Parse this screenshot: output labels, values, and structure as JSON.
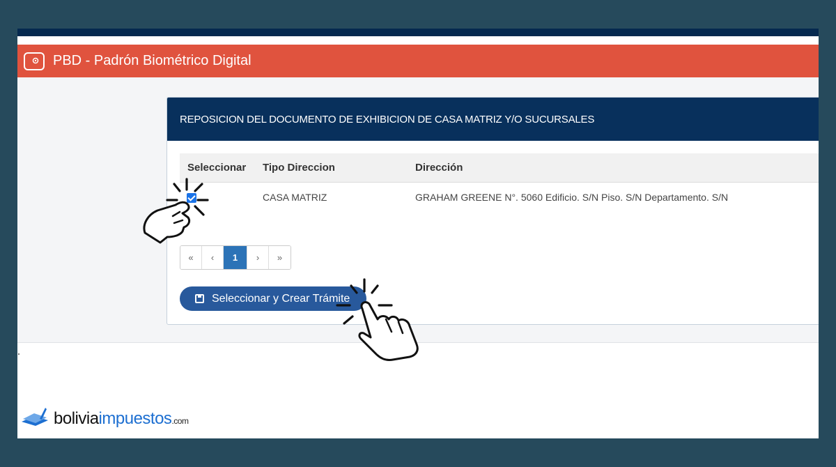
{
  "app": {
    "title": "PBD - Padrón Biométrico Digital"
  },
  "panel": {
    "title": "REPOSICION DEL DOCUMENTO DE EXHIBICION DE CASA MATRIZ Y/O SUCURSALES"
  },
  "table": {
    "headers": [
      "Seleccionar",
      "Tipo Direccion",
      "Dirección"
    ],
    "rows": [
      {
        "selected": true,
        "tipo": "CASA MATRIZ",
        "direccion": "GRAHAM GREENE N°. 5060 Edificio. S/N Piso. S/N Departamento. S/N"
      }
    ]
  },
  "pagination": {
    "first": "«",
    "prev": "‹",
    "current": "1",
    "next": "›",
    "last": "»"
  },
  "actions": {
    "create_label": "Seleccionar y Crear Trámite"
  },
  "brand": {
    "part1": "bolivia",
    "part2": "impuestos",
    "suffix": ".com"
  },
  "icons": [
    "app-logo-icon",
    "save-icon",
    "pointer-hand-icon",
    "brand-logo-icon"
  ],
  "colors": {
    "header_red": "#e0533e",
    "panel_navy": "#08305c",
    "button_blue": "#28599c",
    "page_active": "#2c73b7",
    "frame": "#264a5c"
  }
}
